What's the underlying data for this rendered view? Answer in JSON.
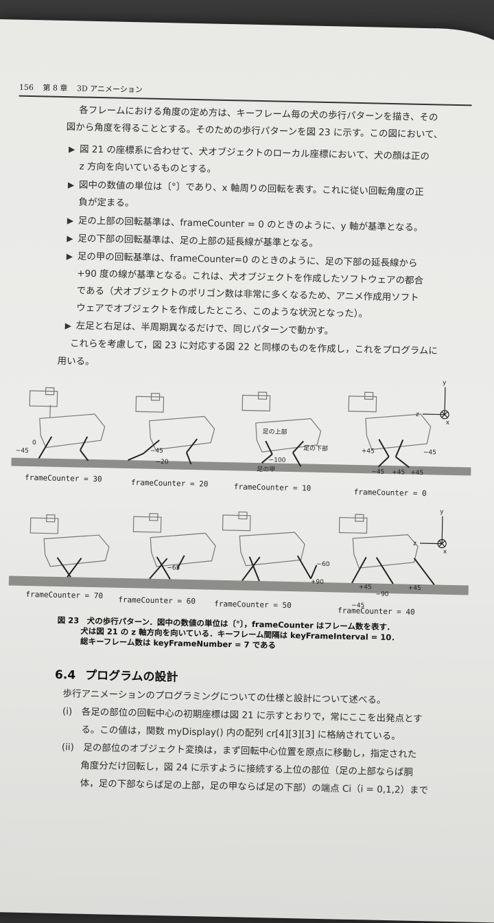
{
  "header": {
    "page_number": "156",
    "chapter": "第 8 章",
    "chapter_title": "3D アニメーション"
  },
  "intro": [
    "各フレームにおける角度の定め方は、キーフレーム毎の犬の歩行パターンを描き、その",
    "図から角度を得ることとする。そのための歩行パターンを図 23 に示す。この図において、"
  ],
  "bullets": [
    [
      "図 21 の座標系に合わせて、犬オブジェクトのローカル座標において、犬の顔は正の",
      "z 方向を向いているものとする。"
    ],
    [
      "図中の数値の単位は〔°〕であり、x 軸周りの回転を表す。これに従い回転角度の正",
      "負が定まる。"
    ],
    [
      "足の上部の回転基準は、frameCounter = 0 のときのように、y 軸が基準となる。"
    ],
    [
      "足の下部の回転基準は、足の上部の延長線が基準となる。"
    ],
    [
      "足の甲の回転基準は、frameCounter=0 のときのように、足の下部の延長線から",
      "+90 度の線が基準となる。これは、犬オブジェクトを作成したソフトウェアの都合",
      "である（犬オブジェクトのポリゴン数は非常に多くなるため、アニメ作成用ソフト",
      "ウェアでオブジェクトを作成したところ、このような状況となった）。"
    ],
    [
      "左足と右足は、半周期異なるだけで、同じパターンで動かす。"
    ]
  ],
  "after_bullets": [
    "これらを考慮して，図 23 に対応する図 22 と同様のものを作成し，これをプログラムに",
    "用いる。"
  ],
  "figure": {
    "row1_labels": [
      "frameCounter = 30",
      "frameCounter = 20",
      "frameCounter = 10",
      "frameCounter = 0"
    ],
    "row2_labels": [
      "frameCounter = 70",
      "frameCounter = 60",
      "frameCounter = 50",
      "frameCounter = 40"
    ],
    "annotations": {
      "upper": "足の上部",
      "lower": "足の下部",
      "instep": "足の甲",
      "axis_y": "y",
      "axis_z": "z",
      "axis_x": "x",
      "a_m45": "−45",
      "a_0": "0",
      "a_m20": "−20",
      "a_m100": "−100",
      "a_p45": "+45",
      "a_m65": "−65",
      "a_m60": "−60",
      "a_p90": "+90",
      "a_m90": "−90"
    }
  },
  "caption": [
    "図 23　犬の歩行パターン．図中の数値の単位は〔°〕，frameCounter はフレーム数を表す．",
    "犬は図 21 の z 軸方向を向いている．キーフレーム間隔は keyFrameInterval = 10．",
    "総キーフレーム数は keyFrameNumber = 7 である"
  ],
  "section": {
    "number": "6.4",
    "title": "プログラムの設計"
  },
  "section_body": [
    "歩行アニメーションのプログラミングについての仕様と設計について述べる。",
    "(i)　各足の部位の回転中心の初期座標は図 21 に示すとおりで，常にここを出発点とす",
    "る。この値は，関数 myDisplay() 内の配列 cr[4][3][3] に格納されている。",
    "(ii)　足の部位のオブジェクト変換は，まず回転中心位置を原点に移動し，指定された",
    "角度分だけ回転し，図 24 に示すように接続する上位の部位（足の上部ならば胴",
    "体，足の下部ならば足の上部，足の甲ならば足の下部）の端点 Ci（i = 0,1,2）まで"
  ]
}
